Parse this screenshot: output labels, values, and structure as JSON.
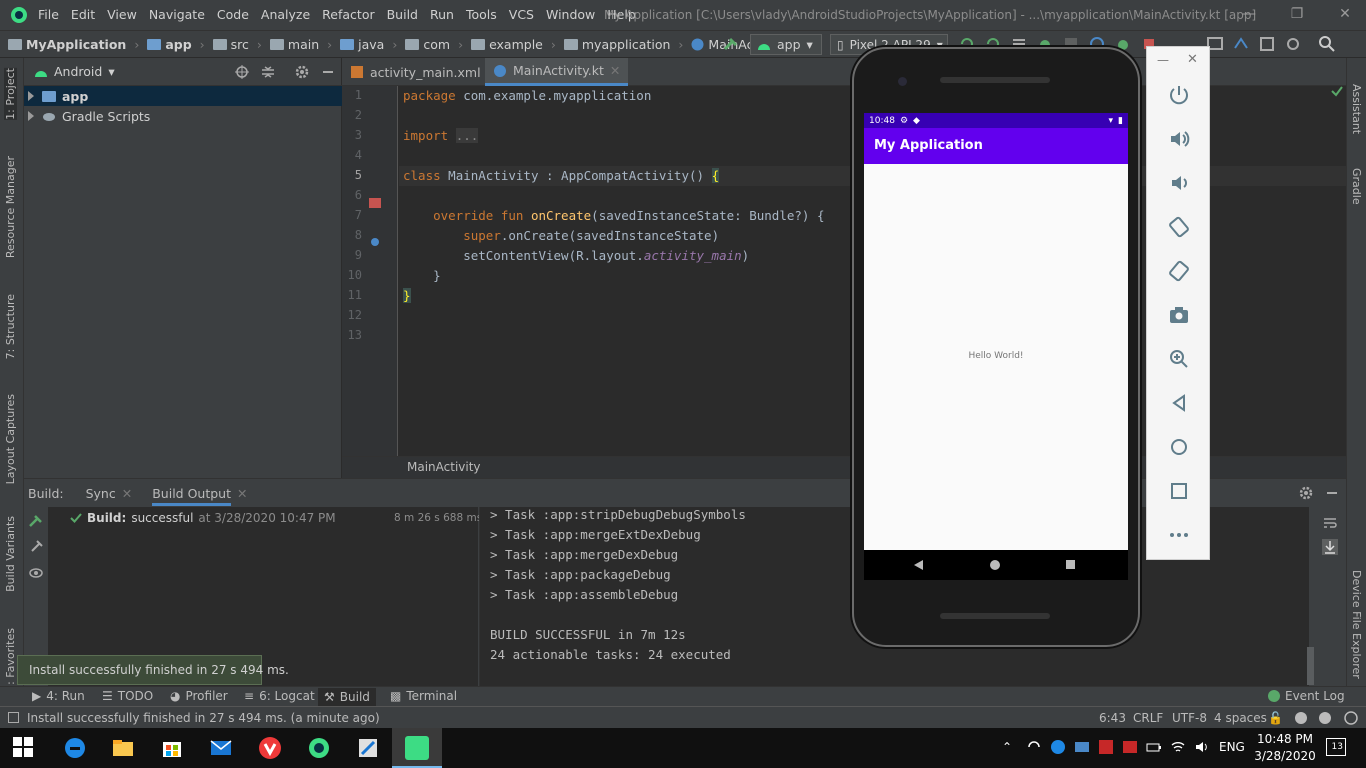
{
  "window": {
    "menu": [
      "File",
      "Edit",
      "View",
      "Navigate",
      "Code",
      "Analyze",
      "Refactor",
      "Build",
      "Run",
      "Tools",
      "VCS",
      "Window",
      "Help"
    ],
    "title": "My Application [C:\\Users\\vlady\\AndroidStudioProjects\\MyApplication] - ...\\myapplication\\MainActivity.kt [app]"
  },
  "breadcrumb": [
    "MyApplication",
    "app",
    "src",
    "main",
    "java",
    "com",
    "example",
    "myapplication",
    "MainActivity"
  ],
  "toolbar": {
    "run_config": "app",
    "device": "Pixel 2 API 29"
  },
  "project": {
    "view": "Android",
    "items": [
      {
        "label": "app",
        "selected": true
      },
      {
        "label": "Gradle Scripts",
        "selected": false
      }
    ]
  },
  "left_tabs": [
    "1: Project",
    "Resource Manager",
    "7: Structure",
    "Layout Captures",
    "Build Variants",
    "2: Favorites"
  ],
  "right_tabs": [
    "Assistant",
    "Gradle",
    "Device File Explorer"
  ],
  "editor": {
    "tabs": [
      {
        "label": "activity_main.xml",
        "active": false
      },
      {
        "label": "MainActivity.kt",
        "active": true
      }
    ],
    "line_numbers": [
      "1",
      "2",
      "3",
      "4",
      "5",
      "6",
      "7",
      "8",
      "9",
      "10",
      "11",
      "12",
      "13"
    ],
    "breadcrumb": "MainActivity"
  },
  "build": {
    "header_label": "Build:",
    "tabs": [
      "Sync",
      "Build Output"
    ],
    "result_label": "Build:",
    "result_text": "successful",
    "result_time": "at 3/28/2020 10:47 PM",
    "duration": "8 m 26 s 688 ms",
    "output": [
      "> Task :app:stripDebugDebugSymbols",
      "> Task :app:mergeExtDexDebug",
      "> Task :app:mergeDexDebug",
      "> Task :app:packageDebug",
      "> Task :app:assembleDebug",
      "",
      "BUILD SUCCESSFUL in 7m 12s",
      "24 actionable tasks: 24 executed"
    ]
  },
  "toast": "Install successfully finished in 27 s 494 ms.",
  "bottom_tabs": [
    "4: Run",
    "TODO",
    "Profiler",
    "6: Logcat",
    "Build",
    "Terminal"
  ],
  "event_log": "Event Log",
  "status": {
    "message": "Install successfully finished in 27 s 494 ms. (a minute ago)",
    "position": "6:43",
    "line_sep": "CRLF",
    "encoding": "UTF-8",
    "indent": "4 spaces"
  },
  "emulator": {
    "time": "10:48",
    "app_title": "My Application",
    "hello": "Hello World!"
  },
  "taskbar": {
    "lang": "ENG",
    "time": "10:48 PM",
    "date": "3/28/2020",
    "notifications": "13"
  },
  "colors": {
    "accent": "#4a88c7",
    "app_bar": "#6200ee",
    "status_bar": "#3700b3",
    "success": "#59a869"
  }
}
